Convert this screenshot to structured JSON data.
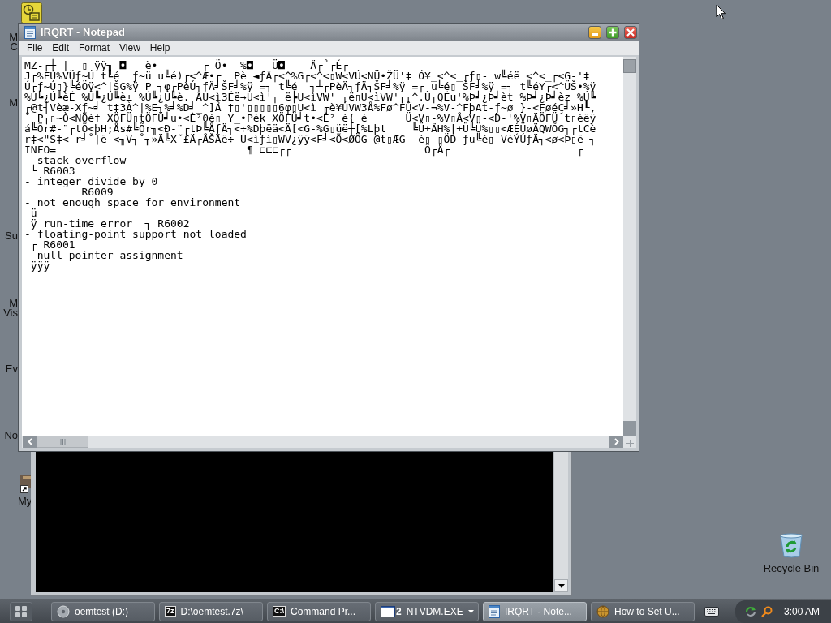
{
  "desktop_icons": [
    {
      "kind": "tile",
      "lines": [
        "M",
        "C"
      ]
    },
    {
      "kind": "hidden",
      "lines": [
        "M"
      ]
    },
    {
      "kind": "hidden",
      "lines": [
        "Su"
      ]
    },
    {
      "kind": "hidden",
      "lines": [
        "M",
        "Vis"
      ]
    },
    {
      "kind": "hidden",
      "lines": [
        "Ev"
      ]
    },
    {
      "kind": "hidden",
      "lines": [
        "No"
      ]
    },
    {
      "kind": "shortcut",
      "lines": [
        "My"
      ]
    },
    {
      "kind": "recycle",
      "lines": [
        "Recycle Bin"
      ]
    }
  ],
  "notepad": {
    "title": "IRQRT - Notepad",
    "menu": [
      "File",
      "Edit",
      "Format",
      "View",
      "Help"
    ],
    "lines": [
      "MZ-┌┼ |  ▯ ÿÿ╖ ◘   è•       ┌ Ö•  %◘   Ü◘    Ä┌˚┌É┌",
      "J┌%FÚ%VÜƒ~Ú t╚é  ƒ~ü u╚é)┌<^Æ•┌  Pè ◄ƒÄ┌<^%G┌<^<▯W<VÚ<NÜ•ŽÜ'‡ Ó¥_<^<_┌ƒ▯- w╚éë <^<_┌<G-'‡",
      "Ú┌ƒ~Ú▯}╚éÖÿ<^|ŠG%ÿ P ┐φ┌PèÚ┐ƒÄ╛ŠF╛%ÿ =┐ t╚é  ┐┴┌PèÄ┐ƒÄ┐ŠF╛%ÿ =┌ u╚é▯ ŠF╛%ÿ =┐ t╚éY┌<^ÜŠ•%ÿ",
      "%Ú╚¿Ú╚èÉ %Ú╚¿Ú╚è± %Ú╚¿Ú╚è. ÄU<ì3Éë→U<ì'┌ ë╞U<ìVW' ┌ë▯U<ìVW'┌┌^.Û┌QÉu'%Þ╛¿Þ╛èt %Þ╛¿Þ╛èz %Ú╚",
      "┌@t┤Vèæ-Xƒ~╛ t‡3À^|%E┐%╛%D╛_^]Å †▯'▯▯▯▯▯6φ▯U<ì ╓è¥ÚVW3Å%Fø^FÛ<V-¬%V-^FþAt-ƒ~ø }-<FøéÇ╛»H┖,",
      "˚ P┬▯~Ò<NÕè† XÖFÜ▯tÖFÜ╛u•<È²0è▯ Y_•Pèk XÖFÜ╛t•<È² è{ é      Ü<V▯-%V▯Å<V▯-<Ð-'%V▯ÄÖFÜ t▯èëÿ",
      "á╚Õr#-¨┌tÕ<þH;Ås#╚Õr╖<Ð-¨┌tÞ╚ÅƒÄ┐<÷%Dþëä<Ä[<G-%G▯üë┼[%Lþt    ╚Ü+ÄH%|+Ü╚Ü%▯▯<ÆÉÜøÄQWÕG┐┌tCè",
      "r‡<\"S‡< r╛˚|ë-<╖V┐˚╖»Ä╚X˝£Ä┌ÅŠÄë÷ U<ìƒì▯WV¿ÿÿ<F╛<Õ<ØÖG-@t▯ÆG- é▯ ▯ÖD-ƒu╚é▯ VèÝÚƒÄ┐<ø<Þ▯ë ┐",
      "INFO=                              ¶ ⊏⊏⊏┌┌                     Õ┌Å┌                    ┌",
      "- stack overflow",
      " └ R6003",
      "- integer divide by 0",
      "         R6009",
      "- not enough space for environment",
      " ü",
      " ÿ run-time error  ┐ R6002",
      "- floating-point support not loaded",
      " ┌ R6001",
      "- null pointer assignment",
      " ÿÿÿ"
    ]
  },
  "taskbar": {
    "tasks": [
      {
        "kind": "drive",
        "label": "oemtest (D:)",
        "selected": false
      },
      {
        "kind": "archive",
        "icon_label": "7z",
        "label": "D:\\oemtest.7z\\",
        "selected": false
      },
      {
        "kind": "console",
        "icon_label": "C:\\",
        "label": "Command Pr...",
        "selected": false
      },
      {
        "kind": "group",
        "count": "2",
        "label": "NTVDM.EXE",
        "selected": false
      },
      {
        "kind": "notepad",
        "label": "IRQRT - Note...",
        "selected": true
      },
      {
        "kind": "browser",
        "label": "How to Set U...",
        "selected": false
      }
    ],
    "clock": "3:00 AM"
  }
}
